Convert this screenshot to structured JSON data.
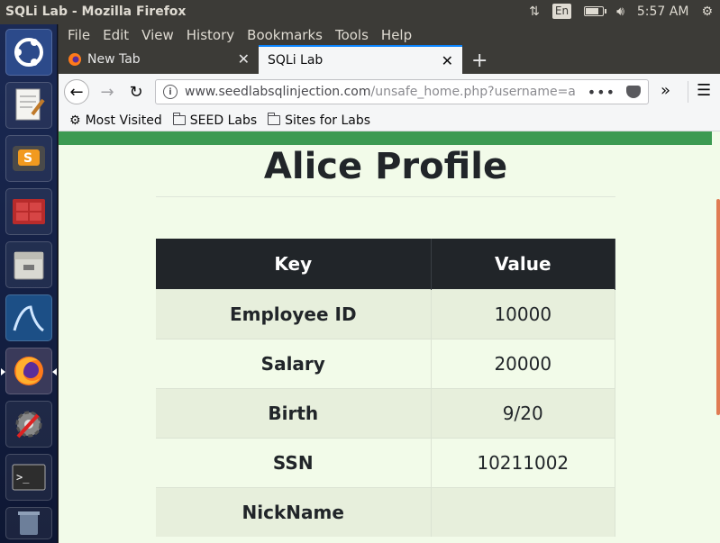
{
  "topbar": {
    "window_title": "SQLi Lab - Mozilla Firefox",
    "lang": "En",
    "time": "5:57 AM"
  },
  "launcher": [
    "dash-home",
    "text-editor",
    "sublime-text",
    "terminal-red",
    "file-manager",
    "wireshark",
    "firefox",
    "system-settings",
    "terminal",
    "trash"
  ],
  "menu": [
    "File",
    "Edit",
    "View",
    "History",
    "Bookmarks",
    "Tools",
    "Help"
  ],
  "tabs": [
    {
      "title": "New Tab",
      "active": false
    },
    {
      "title": "SQLi Lab",
      "active": true
    }
  ],
  "url": {
    "host": "www.seedlabsqlinjection.com",
    "path": "/unsafe_home.php?username=a"
  },
  "bookmarks": [
    "Most Visited",
    "SEED Labs",
    "Sites for Labs"
  ],
  "page": {
    "title": "Alice Profile",
    "table": {
      "headers": [
        "Key",
        "Value"
      ],
      "rows": [
        {
          "key": "Employee ID",
          "value": "10000"
        },
        {
          "key": "Salary",
          "value": "20000"
        },
        {
          "key": "Birth",
          "value": "9/20"
        },
        {
          "key": "SSN",
          "value": "10211002"
        },
        {
          "key": "NickName",
          "value": ""
        }
      ]
    }
  },
  "colors": {
    "accent_green": "#3c9a52",
    "page_bg": "#f2fbe9",
    "table_header": "#212529"
  }
}
